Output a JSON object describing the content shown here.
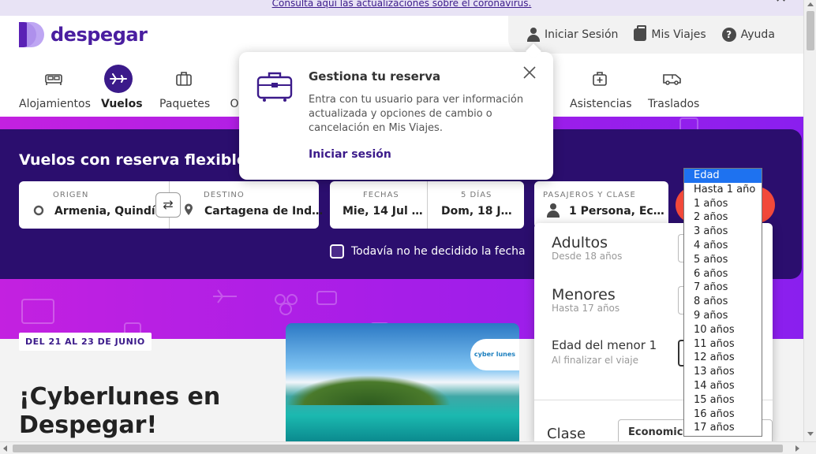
{
  "notice": {
    "text": "Consulta aquí las actualizaciones sobre el coronavirus."
  },
  "brand": {
    "name": "despegar",
    "color": "#4a1ea0"
  },
  "user_nav": {
    "login": "Iniciar Sesión",
    "trips": "Mis Viajes",
    "help": "Ayuda"
  },
  "products": [
    {
      "label": "Alojamientos",
      "icon": "bed-icon"
    },
    {
      "label": "Vuelos",
      "icon": "plane-icon"
    },
    {
      "label": "Paquetes",
      "icon": "suitcase-icon"
    },
    {
      "label": "O"
    },
    {
      "label": "Asistencias",
      "icon": "medical-bag-icon"
    },
    {
      "label": "Traslados",
      "icon": "van-icon"
    }
  ],
  "popover": {
    "title": "Gestiona tu reserva",
    "text": "Entra con tu usuario para ver información actualizada y opciones de cambio o cancelación en Mis Viajes.",
    "link": "Iniciar sesión"
  },
  "search": {
    "title": "Vuelos con reserva flexible",
    "origin_label": "ORIGEN",
    "origin_value": "Armenia, Quindí…",
    "dest_label": "DESTINO",
    "dest_value": "Cartagena de Ind…",
    "dates_label": "FECHAS",
    "date_from": "Mie, 14 Jul …",
    "days_label": "5 DÍAS",
    "date_to": "Dom, 18 J…",
    "pax_label": "PASAJEROS Y CLASE",
    "pax_value": "1 Persona, Ec…",
    "undecided": "Todavía no he decidido la fecha"
  },
  "passengers": {
    "adults_label": "Adultos",
    "adults_sub": "Desde 18 años",
    "minors_label": "Menores",
    "minors_sub": "Hasta 17 años",
    "minor_age_label": "Edad del menor 1",
    "minor_age_sub": "Al finalizar el viaje",
    "class_label": "Clase",
    "class_value": "Economica"
  },
  "age_options": [
    "Edad",
    "Hasta 1 año",
    "1 años",
    "2 años",
    "3 años",
    "4 años",
    "5 años",
    "6 años",
    "7 años",
    "8 años",
    "9 años",
    "10 años",
    "11 años",
    "12 años",
    "13 años",
    "14 años",
    "15 años",
    "16 años",
    "17 años"
  ],
  "promo": {
    "badge": "DEL 21 AL 23 DE JUNIO",
    "title_line1": "¡Cyberlunes en",
    "title_line2": "Despegar!",
    "card_tag": "cyber lunes"
  },
  "colors": {
    "primary": "#3b1a8a",
    "search_panel": "#2b0e6e",
    "cta": "#f2493a",
    "selected_option": "#1e72f0"
  }
}
